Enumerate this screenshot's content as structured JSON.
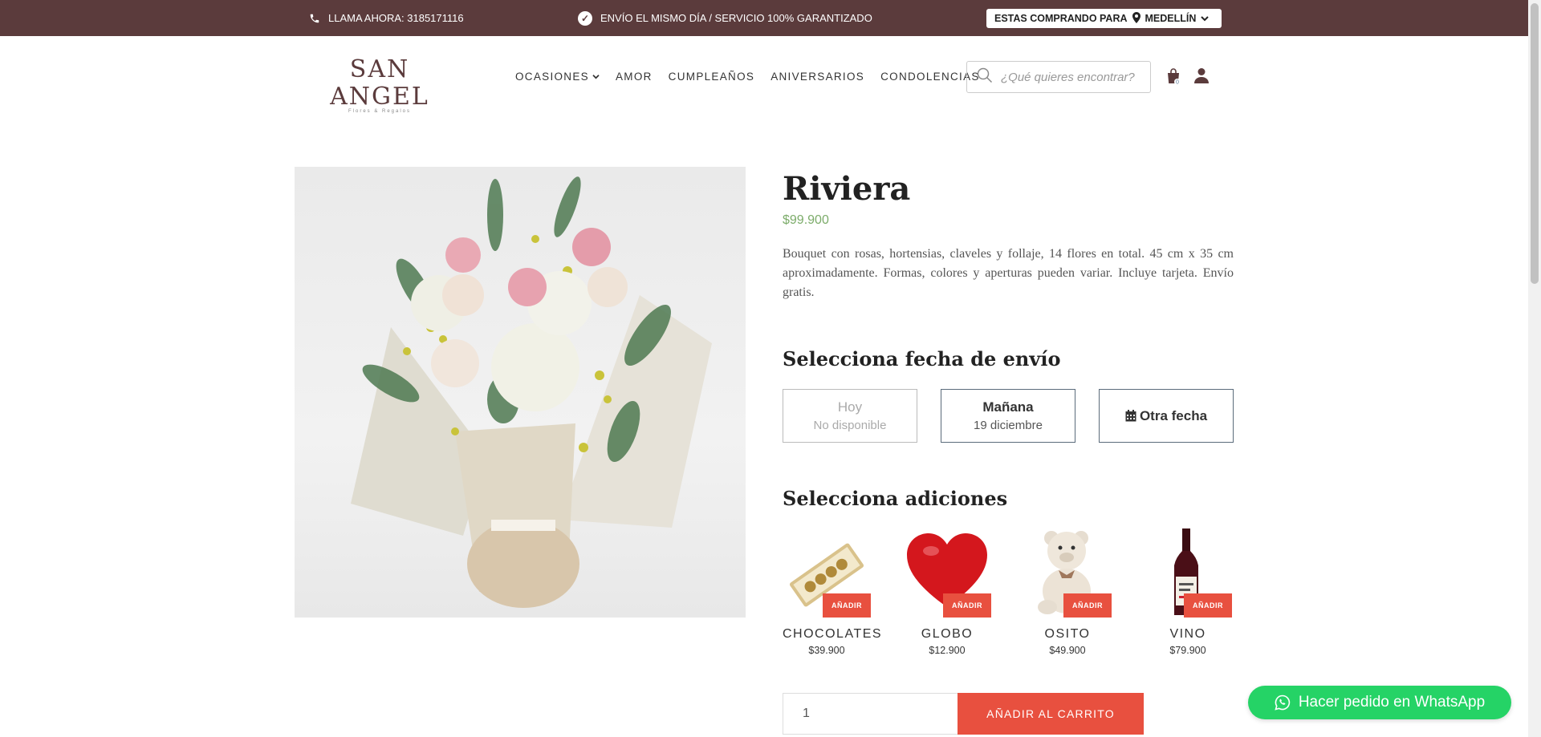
{
  "topbar": {
    "call_text": "LLAMA AHORA: 3185171116",
    "shipping_text": "ENVÍO EL MISMO DÍA / SERVICIO 100% GARANTIZADO",
    "buying_for_label": "ESTAS COMPRANDO PARA",
    "city": "MEDELLÍN"
  },
  "header": {
    "logo_text": "SAN ANGEL",
    "logo_subtitle": "Flores & Regalos",
    "nav": [
      "OCASIONES",
      "AMOR",
      "CUMPLEAÑOS",
      "ANIVERSARIOS",
      "CONDOLENCIAS"
    ],
    "search_placeholder": "¿Qué quieres encontrar?",
    "cart_count": "0"
  },
  "product": {
    "title": "Riviera",
    "price": "$99.900",
    "description": "Bouquet con rosas, hortensias, claveles y follaje, 14 flores en total. 45  cm x 35 cm aproximadamente. Formas, colores y aperturas pueden variar. Incluye tarjeta. Envío gratis."
  },
  "delivery": {
    "section_title": "Selecciona fecha de envío",
    "options": [
      {
        "label": "Hoy",
        "sub": "No disponible",
        "disabled": true
      },
      {
        "label": "Mañana",
        "sub": "19 diciembre",
        "disabled": false
      },
      {
        "label": "Otra fecha",
        "icon": "calendar-icon"
      }
    ]
  },
  "addons": {
    "section_title": "Selecciona adiciones",
    "add_label": "AÑADIR",
    "items": [
      {
        "name": "CHOCOLATES",
        "price": "$39.900"
      },
      {
        "name": "GLOBO",
        "price": "$12.900"
      },
      {
        "name": "OSITO",
        "price": "$49.900"
      },
      {
        "name": "VINO",
        "price": "$79.900"
      }
    ]
  },
  "cart": {
    "quantity": "1",
    "add_to_cart_label": "AÑADIR AL CARRITO"
  },
  "whatsapp": {
    "label": "Hacer pedido en WhatsApp"
  },
  "colors": {
    "topbar_bg": "#5b3b3c",
    "price_green": "#7cac6a",
    "accent_red": "#e8503f",
    "whatsapp_green": "#25d366"
  }
}
